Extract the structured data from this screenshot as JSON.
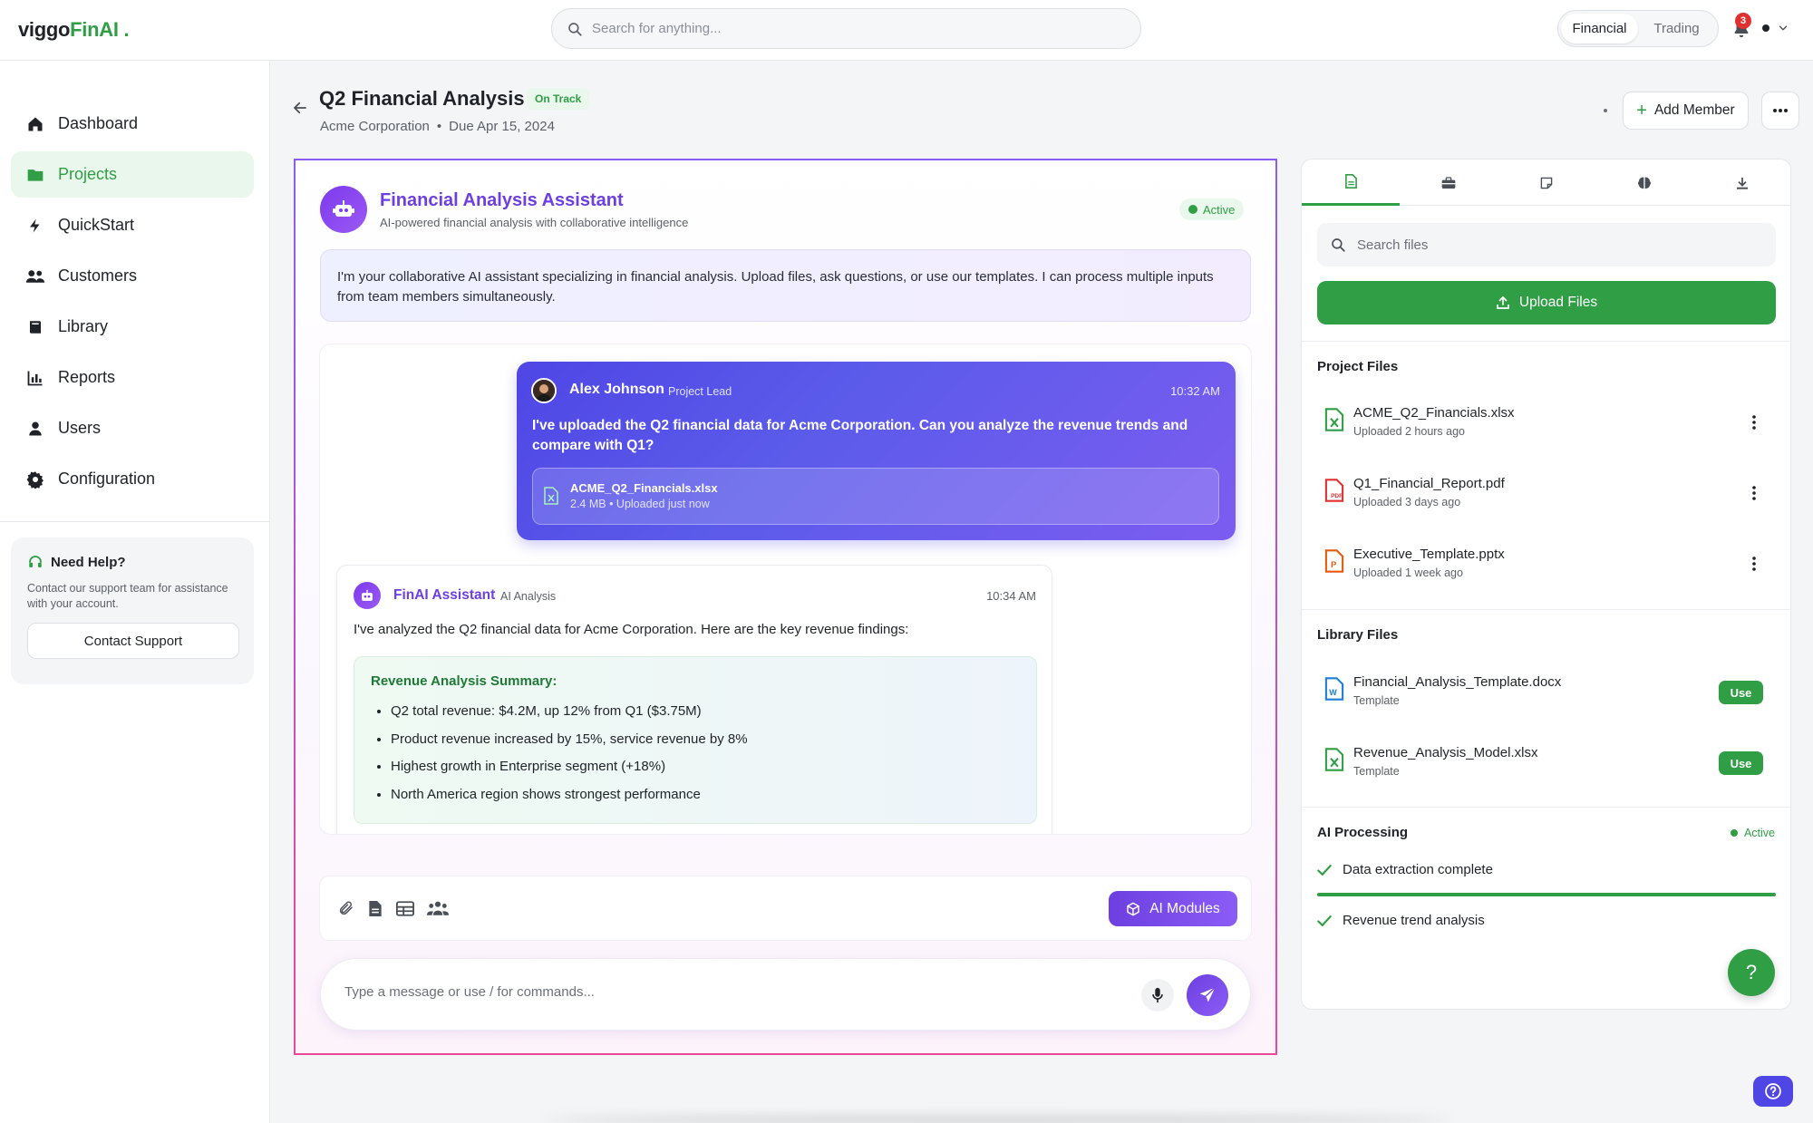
{
  "app": {
    "logo_main": "viggo",
    "logo_accent": "FinAI",
    "logo_suffix": " ."
  },
  "topbar": {
    "search_placeholder": "Search for anything...",
    "toggle_options": [
      "Financial",
      "Trading"
    ],
    "notification_count": "3"
  },
  "sidebar": {
    "items": [
      {
        "label": "Dashboard",
        "icon": "home-icon"
      },
      {
        "label": "Projects",
        "icon": "folder-icon"
      },
      {
        "label": "QuickStart",
        "icon": "lightning-icon"
      },
      {
        "label": "Customers",
        "icon": "users-icon"
      },
      {
        "label": "Library",
        "icon": "book-icon"
      },
      {
        "label": "Reports",
        "icon": "chart-icon"
      },
      {
        "label": "Users",
        "icon": "user-icon"
      },
      {
        "label": "Configuration",
        "icon": "gear-icon"
      }
    ],
    "active_index": 1,
    "help": {
      "title": "Need Help?",
      "text": "Contact our support team for assistance with your account.",
      "button": "Contact Support"
    }
  },
  "header": {
    "title": "Q2 Financial Analysis",
    "status": "On Track",
    "company": "Acme Corporation",
    "separator": "•",
    "due": "Due Apr 15, 2024",
    "add_member": "Add Member"
  },
  "chat": {
    "assistant_name": "Financial Analysis Assistant",
    "assistant_desc": "AI-powered financial analysis with collaborative intelligence",
    "status": "Active",
    "intro": "I'm your collaborative AI assistant specializing in financial analysis. Upload files, ask questions, or use our templates. I can process multiple inputs from team members simultaneously.",
    "user_message": {
      "name": "Alex Johnson",
      "role": "Project Lead",
      "time": "10:32 AM",
      "text": "I've uploaded the Q2 financial data for Acme Corporation. Can you analyze the revenue trends and compare with Q1?",
      "attachment_name": "ACME_Q2_Financials.xlsx",
      "attachment_meta": "2.4 MB • Uploaded just now"
    },
    "ai_message": {
      "name": "FinAI Assistant",
      "tag": "AI Analysis",
      "time": "10:34 AM",
      "text": "I've analyzed the Q2 financial data for Acme Corporation. Here are the key revenue findings:",
      "summary_title": "Revenue Analysis Summary:",
      "summary_items": [
        "Q2 total revenue: $4.2M, up 12% from Q1 ($3.75M)",
        "Product revenue increased by 15%, service revenue by 8%",
        "Highest growth in Enterprise segment (+18%)",
        "North America region shows strongest performance"
      ]
    },
    "toolbar_icons": [
      "paperclip-icon",
      "document-icon",
      "table-icon",
      "team-icon"
    ],
    "ai_modules": "AI Modules",
    "composer_placeholder": "Type a message or use / for commands..."
  },
  "files_panel": {
    "tabs": [
      "document-tab-icon",
      "briefcase-tab-icon",
      "note-tab-icon",
      "brain-tab-icon",
      "download-tab-icon"
    ],
    "search_placeholder": "Search files",
    "upload": "Upload Files",
    "project_title": "Project Files",
    "project_files": [
      {
        "name": "ACME_Q2_Financials.xlsx",
        "meta": "Uploaded 2 hours ago",
        "type": "xlsx"
      },
      {
        "name": "Q1_Financial_Report.pdf",
        "meta": "Uploaded 3 days ago",
        "type": "pdf"
      },
      {
        "name": "Executive_Template.pptx",
        "meta": "Uploaded 1 week ago",
        "type": "pptx"
      }
    ],
    "library_title": "Library Files",
    "library_files": [
      {
        "name": "Financial_Analysis_Template.docx",
        "meta": "Template",
        "type": "docx",
        "action": "Use"
      },
      {
        "name": "Revenue_Analysis_Model.xlsx",
        "meta": "Template",
        "type": "xlsx",
        "action": "Use"
      }
    ],
    "processing_title": "AI Processing",
    "processing_status": "Active",
    "processing_steps": [
      "Data extraction complete",
      "Revenue trend analysis"
    ],
    "processing_progress": 1.0
  },
  "colors": {
    "brand_green": "#2f9e44",
    "ai_purple": "#6d3fe0",
    "user_bubble": "#4f46e5"
  },
  "fab": {
    "help": "?"
  }
}
